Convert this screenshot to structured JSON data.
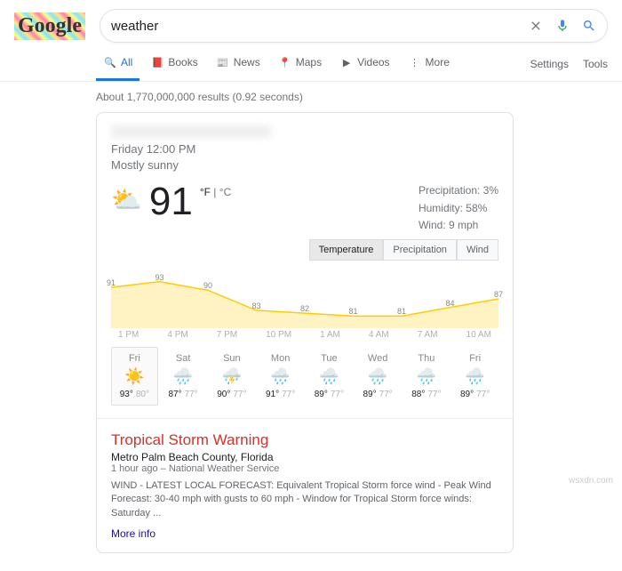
{
  "header": {
    "logo": "Google",
    "query": "weather"
  },
  "nav": {
    "tabs": [
      {
        "label": "All",
        "active": true
      },
      {
        "label": "Books"
      },
      {
        "label": "News"
      },
      {
        "label": "Maps"
      },
      {
        "label": "Videos"
      },
      {
        "label": "More"
      }
    ],
    "settings": "Settings",
    "tools": "Tools"
  },
  "stats": "About 1,770,000,000 results (0.92 seconds)",
  "weather": {
    "when": "Friday 12:00 PM",
    "condition": "Mostly sunny",
    "temp": "91",
    "unit_f": "°F",
    "unit_sep": " | ",
    "unit_c": "°C",
    "precip_label": "Precipitation: 3%",
    "humidity_label": "Humidity: 58%",
    "wind_label": "Wind: 9 mph",
    "chart_tabs": {
      "temp": "Temperature",
      "precip": "Precipitation",
      "wind": "Wind"
    },
    "hours": [
      "1 PM",
      "4 PM",
      "7 PM",
      "10 PM",
      "1 AM",
      "4 AM",
      "7 AM",
      "10 AM"
    ],
    "forecast": [
      {
        "day": "Fri",
        "icon": "☀️",
        "hi": "93°",
        "lo": "80°",
        "active": true
      },
      {
        "day": "Sat",
        "icon": "🌧️",
        "hi": "87°",
        "lo": "77°"
      },
      {
        "day": "Sun",
        "icon": "⛈️",
        "hi": "90°",
        "lo": "77°"
      },
      {
        "day": "Mon",
        "icon": "🌧️",
        "hi": "91°",
        "lo": "77°"
      },
      {
        "day": "Tue",
        "icon": "🌧️",
        "hi": "89°",
        "lo": "77°"
      },
      {
        "day": "Wed",
        "icon": "🌧️",
        "hi": "89°",
        "lo": "77°"
      },
      {
        "day": "Thu",
        "icon": "🌧️",
        "hi": "88°",
        "lo": "77°"
      },
      {
        "day": "Fri",
        "icon": "🌧️",
        "hi": "89°",
        "lo": "77°"
      }
    ]
  },
  "alert": {
    "title": "Tropical Storm Warning",
    "location": "Metro Palm Beach County, Florida",
    "meta": "1 hour ago – National Weather Service",
    "body": "WIND - LATEST LOCAL FORECAST: Equivalent Tropical Storm force wind - Peak Wind Forecast: 30-40 mph with gusts to 60 mph - Window for Tropical Storm force winds: Saturday ...",
    "more": "More info"
  },
  "chart_data": {
    "type": "line",
    "title": "Hourly temperature",
    "xlabel": "",
    "ylabel": "°F",
    "categories": [
      "1 PM",
      "4 PM",
      "7 PM",
      "10 PM",
      "1 AM",
      "4 AM",
      "7 AM",
      "10 AM",
      ""
    ],
    "values": [
      91,
      93,
      90,
      83,
      82,
      81,
      81,
      84,
      87
    ],
    "ylim": [
      78,
      96
    ]
  },
  "watermark": "wsxdn.com"
}
